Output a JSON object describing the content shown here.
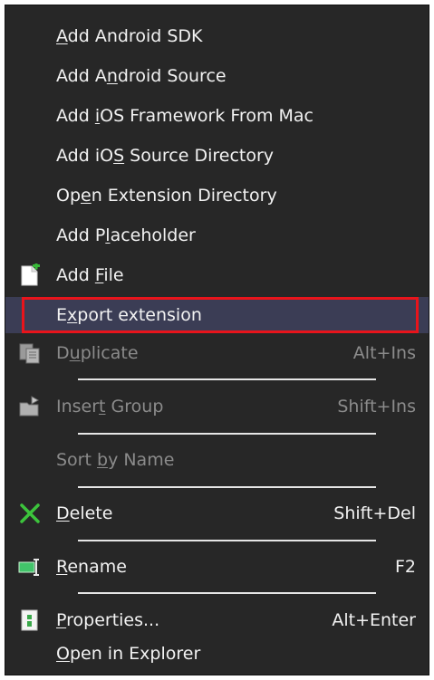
{
  "menu": {
    "items": [
      {
        "pre": "",
        "mn": "A",
        "post": "dd Android SDK",
        "shortcut": ""
      },
      {
        "pre": "Add A",
        "mn": "n",
        "post": "droid Source",
        "shortcut": ""
      },
      {
        "pre": "Add ",
        "mn": "i",
        "post": "OS Framework From Mac",
        "shortcut": ""
      },
      {
        "pre": "Add iO",
        "mn": "S",
        "post": " Source Directory",
        "shortcut": ""
      },
      {
        "pre": "Op",
        "mn": "e",
        "post": "n Extension Directory",
        "shortcut": ""
      },
      {
        "pre": "Add P",
        "mn": "l",
        "post": "aceholder",
        "shortcut": ""
      },
      {
        "pre": "Add ",
        "mn": "F",
        "post": "ile",
        "shortcut": ""
      },
      {
        "pre": "E",
        "mn": "x",
        "post": "port extension",
        "shortcut": ""
      },
      {
        "pre": "D",
        "mn": "u",
        "post": "plicate",
        "shortcut": "Alt+Ins"
      },
      {
        "pre": "Inser",
        "mn": "t",
        "post": " Group",
        "shortcut": "Shift+Ins"
      },
      {
        "pre": "Sort ",
        "mn": "b",
        "post": "y Name",
        "shortcut": ""
      },
      {
        "pre": "",
        "mn": "D",
        "post": "elete",
        "shortcut": "Shift+Del"
      },
      {
        "pre": "",
        "mn": "R",
        "post": "ename",
        "shortcut": "F2"
      },
      {
        "pre": "",
        "mn": "P",
        "post": "roperties...",
        "shortcut": "Alt+Enter"
      },
      {
        "pre": "",
        "mn": "O",
        "post": "pen in Explorer",
        "shortcut": ""
      }
    ],
    "icons": {
      "add_file": "add-file-icon",
      "duplicate": "duplicate-icon",
      "insert_group": "insert-group-icon",
      "delete": "delete-icon",
      "rename": "rename-icon",
      "properties": "properties-icon"
    },
    "colors": {
      "background": "#272727",
      "text": "#f2f2f2",
      "disabled_text": "#8b8b8b",
      "selected_bg": "#3b3d55",
      "highlight_border": "#e8141b",
      "delete_icon": "#3cc43c"
    }
  }
}
